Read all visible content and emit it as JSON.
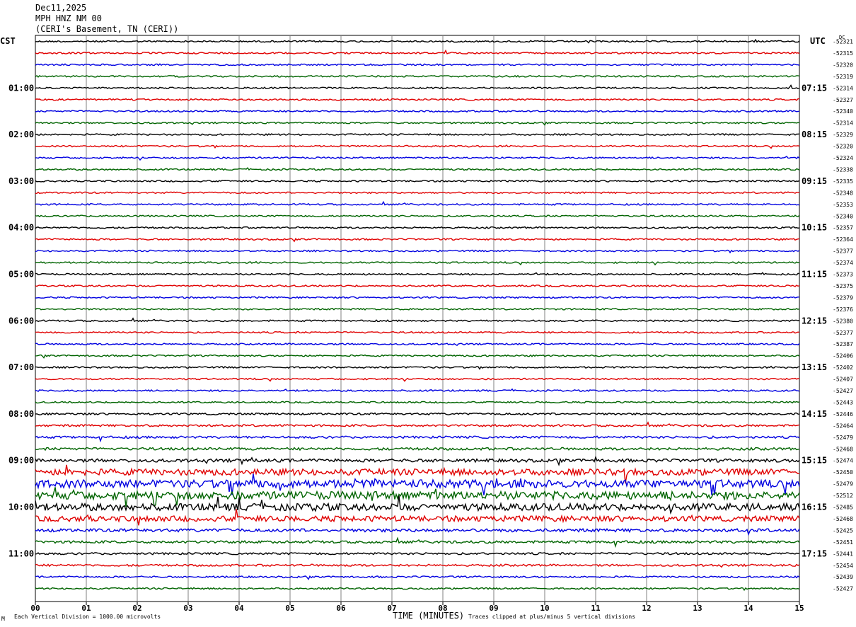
{
  "header": {
    "date": "Dec11,2025",
    "station": "MPH HNZ NM 00",
    "location": "(CERI's Basement, TN (CERI))"
  },
  "left_label": "CST",
  "right_label": "UTC",
  "dc_label": "DC",
  "footer": {
    "scale": "Each Vertical Division = 1000.00 microvolts",
    "clip": "Traces clipped at plus/minus 5 vertical divisions",
    "mark": "M"
  },
  "colors": {
    "trace_cycle": [
      "#000000",
      "#e00000",
      "#0000e0",
      "#006400"
    ],
    "grid": "#808080"
  },
  "chart_data": {
    "type": "line",
    "title": "MPH HNZ NM 00",
    "xlabel": "TIME (MINUTES)",
    "ylabel": "",
    "xlim": [
      0,
      15
    ],
    "x_ticks": [
      "00",
      "01",
      "02",
      "03",
      "04",
      "05",
      "06",
      "07",
      "08",
      "09",
      "10",
      "11",
      "12",
      "13",
      "14",
      "15"
    ],
    "left_time_labels": [
      {
        "row": 4,
        "text": "01:00"
      },
      {
        "row": 8,
        "text": "02:00"
      },
      {
        "row": 12,
        "text": "03:00"
      },
      {
        "row": 16,
        "text": "04:00"
      },
      {
        "row": 20,
        "text": "05:00"
      },
      {
        "row": 24,
        "text": "06:00"
      },
      {
        "row": 28,
        "text": "07:00"
      },
      {
        "row": 32,
        "text": "08:00"
      },
      {
        "row": 36,
        "text": "09:00"
      },
      {
        "row": 40,
        "text": "10:00"
      },
      {
        "row": 44,
        "text": "11:00"
      }
    ],
    "right_time_labels": [
      {
        "row": 4,
        "text": "07:15"
      },
      {
        "row": 8,
        "text": "08:15"
      },
      {
        "row": 12,
        "text": "09:15"
      },
      {
        "row": 16,
        "text": "10:15"
      },
      {
        "row": 20,
        "text": "11:15"
      },
      {
        "row": 24,
        "text": "12:15"
      },
      {
        "row": 28,
        "text": "13:15"
      },
      {
        "row": 32,
        "text": "14:15"
      },
      {
        "row": 36,
        "text": "15:15"
      },
      {
        "row": 40,
        "text": "16:15"
      },
      {
        "row": 44,
        "text": "17:15"
      }
    ],
    "dc_offsets": [
      "-52321",
      "-52315",
      "-52320",
      "-52319",
      "-52314",
      "-52327",
      "-52340",
      "-52314",
      "-52329",
      "-52320",
      "-52324",
      "-52338",
      "-52335",
      "-52348",
      "-52353",
      "-52340",
      "-52357",
      "-52364",
      "-52377",
      "-52374",
      "-52373",
      "-52375",
      "-52379",
      "-52376",
      "-52380",
      "-52377",
      "-52387",
      "-52406",
      "-52402",
      "-52407",
      "-52427",
      "-52443",
      "-52446",
      "-52464",
      "-52479",
      "-52468",
      "-52474",
      "-52450",
      "-52479",
      "-52512",
      "-52485",
      "-52468",
      "-52425",
      "-52451",
      "-52441",
      "-52454",
      "-52439",
      "-52427"
    ],
    "trace_activity": [
      1,
      1,
      1,
      1,
      1,
      1,
      1,
      1,
      1,
      1,
      1,
      1,
      1,
      1,
      1,
      1,
      1,
      1,
      1,
      1,
      1,
      1,
      1,
      1,
      1,
      1,
      1,
      1,
      1,
      1,
      1,
      1,
      1.2,
      1.3,
      1.4,
      1.6,
      2,
      4,
      5,
      5,
      4.5,
      3.5,
      2,
      1.6,
      1.3,
      1.3,
      1.1,
      1
    ]
  }
}
